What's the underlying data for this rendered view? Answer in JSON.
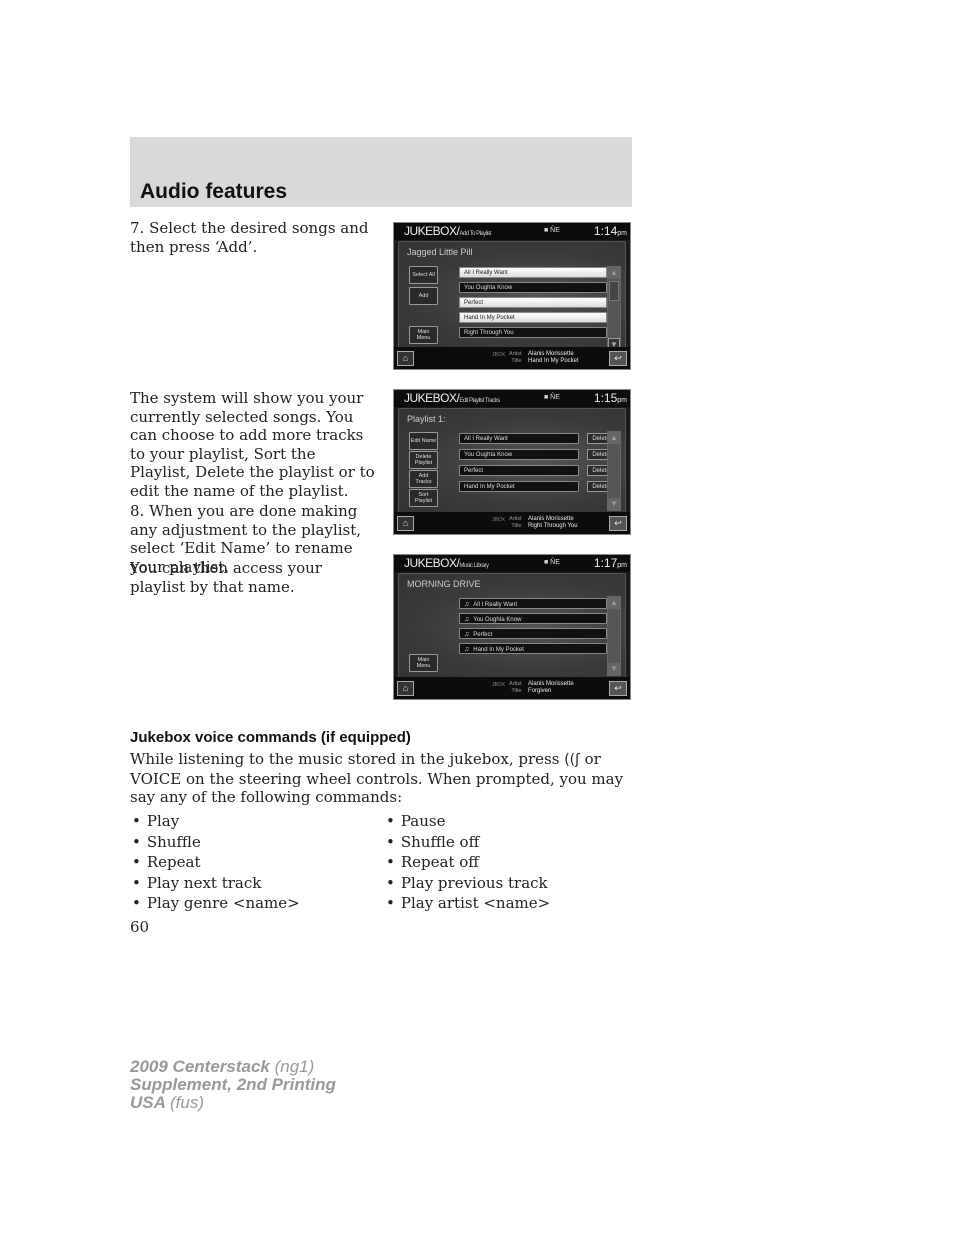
{
  "header": {
    "title": "Audio features"
  },
  "steps": {
    "step7": "7. Select the desired songs and then press ‘Add’.",
    "system_note": "The system will show you your currently selected songs. You can choose to add more tracks to your playlist, Sort the Playlist, Delete the playlist or to edit the name of the playlist.",
    "step8": "8. When you are done making any adjustment to the playlist, select ‘Edit Name’ to rename your playlist.",
    "access_note": "You can then access your playlist by that name."
  },
  "screens": [
    {
      "brand": "JUKEBOX/",
      "subtitle": "Add To Playlist",
      "nav": "■ N̂E",
      "time": "1:14",
      "ampm": "pm",
      "heading": "Jagged Little Pill",
      "buttons": [
        "Select All",
        "Add",
        "Main Menu"
      ],
      "tracks": [
        {
          "title": "All I Really Want",
          "style": "light"
        },
        {
          "title": "You Oughta Know",
          "style": "dark"
        },
        {
          "title": "Perfect",
          "style": "light"
        },
        {
          "title": "Hand In My Pocket",
          "style": "light"
        },
        {
          "title": "Right Through You",
          "style": "dark"
        }
      ],
      "now_playing": {
        "source": "JBOX",
        "artist_label": "Artist",
        "title_label": "Title",
        "artist": "Alanis Morissette",
        "title": "Hand In My Pocket"
      }
    },
    {
      "brand": "JUKEBOX/",
      "subtitle": "Edit Playlist Tracks",
      "nav": "■ N̂E",
      "time": "1:15",
      "ampm": "pm",
      "heading": "Playlist 1:",
      "buttons": [
        "Edit Name",
        "Delete Playlist",
        "Add Tracks",
        "Sort Playlist"
      ],
      "tracks": [
        {
          "title": "All I Really Want",
          "action": "Delete"
        },
        {
          "title": "You Oughta Know",
          "action": "Delete"
        },
        {
          "title": "Perfect",
          "action": "Delete"
        },
        {
          "title": "Hand In My Pocket",
          "action": "Delete"
        }
      ],
      "now_playing": {
        "source": "JBOX",
        "artist_label": "Artist",
        "title_label": "Title",
        "artist": "Alanis Morissette",
        "title": "Right Through You"
      }
    },
    {
      "brand": "JUKEBOX/",
      "subtitle": "Music Library",
      "nav": "■ N̂E",
      "time": "1:17",
      "ampm": "pm",
      "heading": "MORNING DRIVE",
      "buttons": [
        "Main Menu"
      ],
      "tracks": [
        {
          "title": "All I Really Want"
        },
        {
          "title": "You Oughta Know"
        },
        {
          "title": "Perfect"
        },
        {
          "title": "Hand In My Pocket"
        }
      ],
      "now_playing": {
        "source": "JBOX",
        "artist_label": "Artist",
        "title_label": "Title",
        "artist": "Alanis Morissette",
        "title": "Forgiven"
      }
    }
  ],
  "icons": {
    "home": "⌂",
    "back": "↩",
    "up": "▲",
    "down": "▼",
    "note": "♫",
    "voice": "((ʃ"
  },
  "voice": {
    "title": "Jukebox voice commands (if equipped)",
    "intro_before_icon": "While listening to the music stored in the jukebox, press",
    "intro_after_icon": " or VOICE on the steering wheel controls. When prompted, you may say any of the following commands:",
    "left_commands": [
      "Play",
      "Shuffle",
      "Repeat",
      "Play next track",
      "Play genre <name>"
    ],
    "right_commands": [
      "Pause",
      "Shuffle off",
      "Repeat off",
      "Play previous track",
      "Play artist <name>"
    ]
  },
  "page_number": "60",
  "footer": {
    "line1_bold": "2009 Centerstack",
    "line1_code": "(ng1)",
    "line2_bold": "Supplement, 2nd Printing",
    "line3_bold": "USA",
    "line3_code": "(fus)"
  }
}
